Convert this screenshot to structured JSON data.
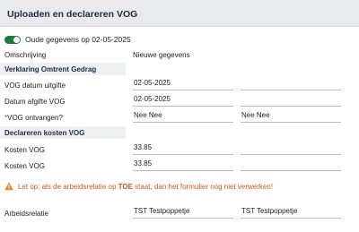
{
  "header": {
    "title": "Uploaden en declareren VOG"
  },
  "toggle": {
    "label": "Oude gegevens op 02-05-2025",
    "state": "on",
    "color": "#1e7a3c"
  },
  "columns": {
    "omschrijving": "Omschrijving",
    "nieuwe": "Nieuwe gegevens"
  },
  "sections": {
    "verklaring": "Verklaring Omtrent Gedrag",
    "declareren": "Declareren kosten VOG"
  },
  "rows": {
    "datum_uitgifte": {
      "label": "VOG datum uitgifte",
      "old": "02-05-2025",
      "new": ""
    },
    "datum_afgifte": {
      "label": "Datum afgifte VOG",
      "old": "02-05-2025",
      "new": ""
    },
    "ontvangen": {
      "required_mark": "*",
      "label": "VOG ontvangen?",
      "old": "Nee Nee",
      "new": "Nee Nee"
    },
    "kosten1": {
      "label": "Kosten VOG",
      "old": "33.85",
      "new": ""
    },
    "kosten2": {
      "label": "Kosten VOG",
      "old": "33.85",
      "new": ""
    },
    "arbeidsrelatie": {
      "label": "Arbeidsrelatie",
      "old": "TST Testpoppetje",
      "new": "TST Testpoppetje"
    }
  },
  "warning": {
    "icon": "warning-triangle-icon",
    "prefix": "Let op: als de arbeidsrelatie op ",
    "emphasis": "TOE",
    "suffix": " staat, dan het formulier nog niet verwerken!",
    "color": "#d9541e"
  }
}
